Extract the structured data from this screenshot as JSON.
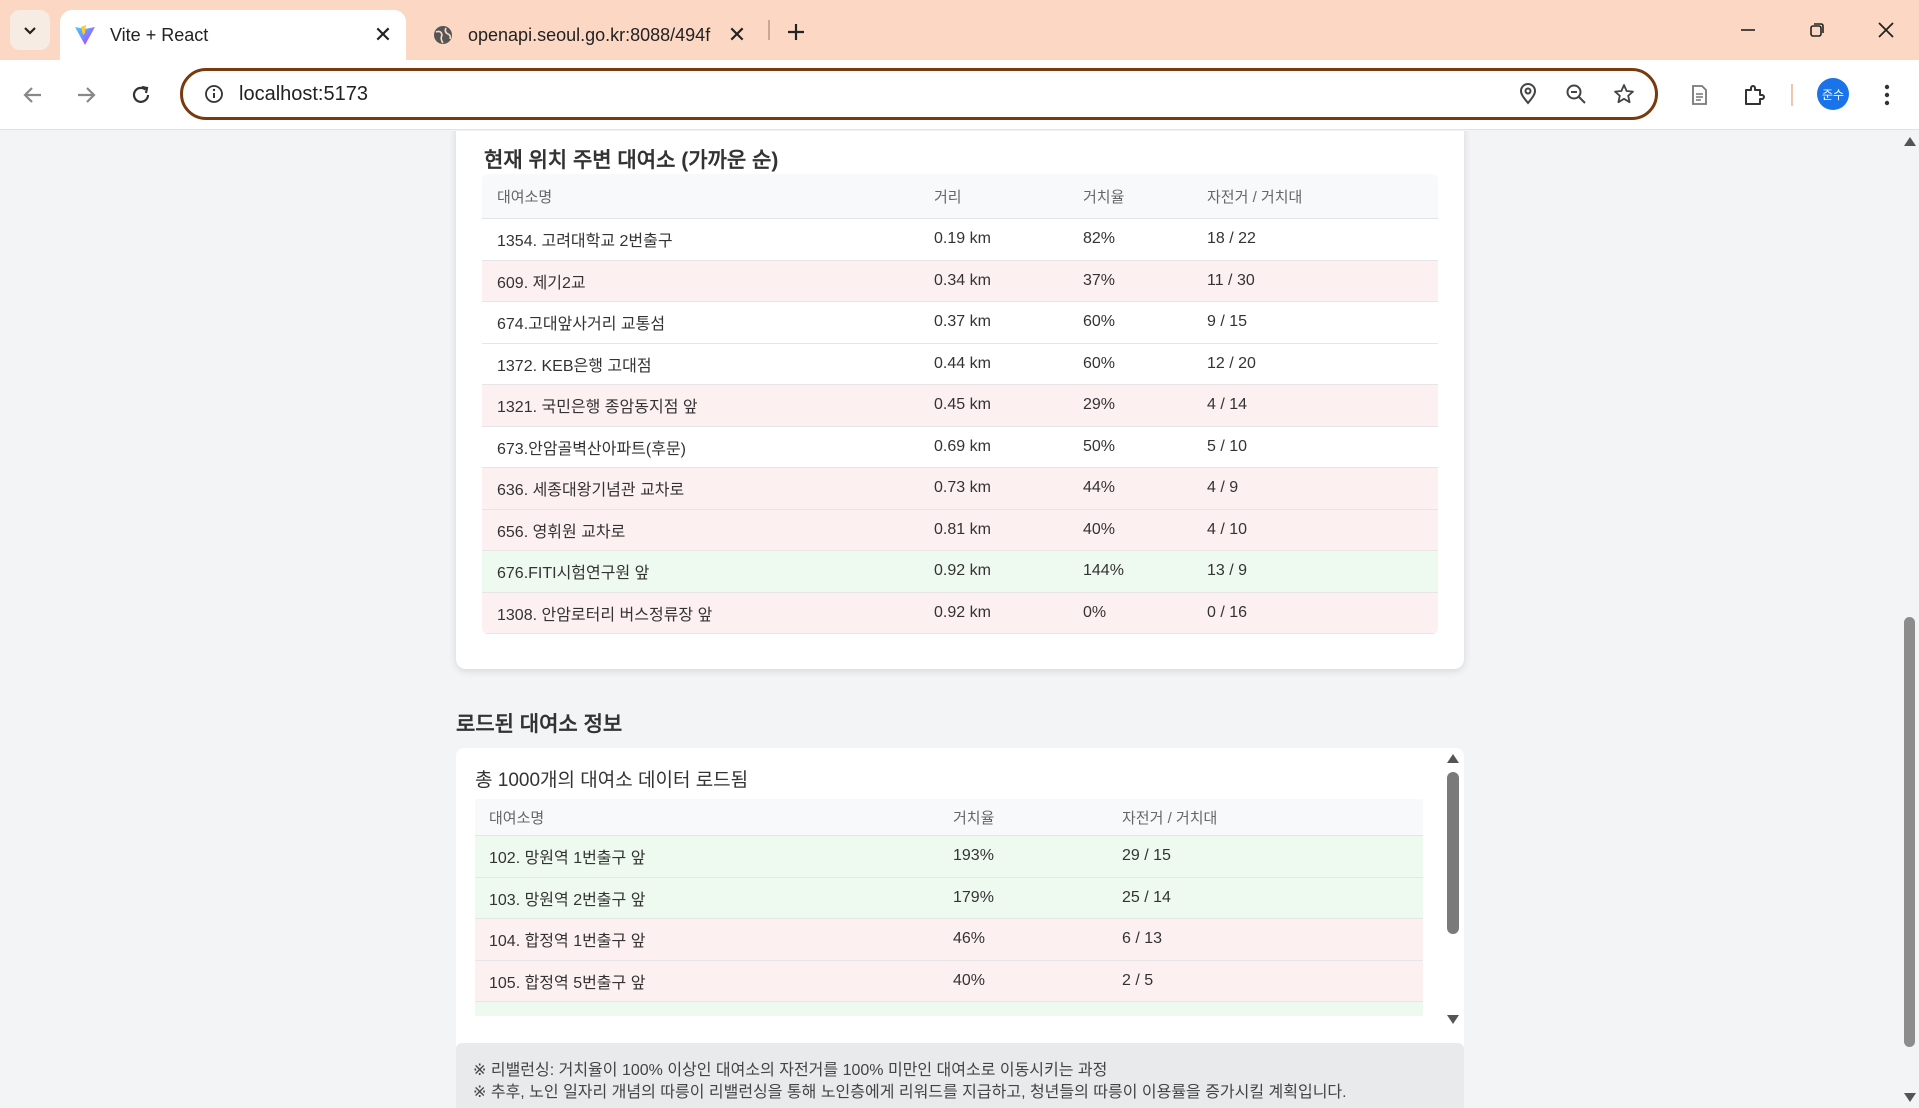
{
  "browser": {
    "tabs": [
      {
        "title": "Vite + React",
        "active": true,
        "icon": "vite-logo-icon"
      },
      {
        "title": "openapi.seoul.go.kr:8088/494f",
        "active": false,
        "icon": "globe-icon"
      }
    ],
    "url": "localhost:5173",
    "profile_initials": "준수"
  },
  "nearby": {
    "title": "현재 위치 주변 대여소 (가까운 순)",
    "columns": [
      "대여소명",
      "거리",
      "거치율",
      "자전거 / 거치대"
    ],
    "rows": [
      {
        "name": "1354. 고려대학교 2번출구",
        "distance": "0.19 km",
        "rate": "82%",
        "bikes": "18 / 22",
        "status": "normal"
      },
      {
        "name": "609. 제기2교",
        "distance": "0.34 km",
        "rate": "37%",
        "bikes": "11 / 30",
        "status": "low"
      },
      {
        "name": "674.고대앞사거리 교통섬",
        "distance": "0.37 km",
        "rate": "60%",
        "bikes": "9 / 15",
        "status": "normal"
      },
      {
        "name": "1372. KEB은행 고대점",
        "distance": "0.44 km",
        "rate": "60%",
        "bikes": "12 / 20",
        "status": "normal"
      },
      {
        "name": "1321. 국민은행 종암동지점 앞",
        "distance": "0.45 km",
        "rate": "29%",
        "bikes": "4 / 14",
        "status": "low"
      },
      {
        "name": "673.안암골벽산아파트(후문)",
        "distance": "0.69 km",
        "rate": "50%",
        "bikes": "5 / 10",
        "status": "normal"
      },
      {
        "name": "636. 세종대왕기념관 교차로",
        "distance": "0.73 km",
        "rate": "44%",
        "bikes": "4 / 9",
        "status": "low"
      },
      {
        "name": "656. 영휘원 교차로",
        "distance": "0.81 km",
        "rate": "40%",
        "bikes": "4 / 10",
        "status": "low"
      },
      {
        "name": "676.FITI시험연구원 앞",
        "distance": "0.92 km",
        "rate": "144%",
        "bikes": "13 / 9",
        "status": "high"
      },
      {
        "name": "1308. 안암로터리 버스정류장 앞",
        "distance": "0.92 km",
        "rate": "0%",
        "bikes": "0 / 16",
        "status": "low"
      }
    ]
  },
  "loaded": {
    "section_title": "로드된 대여소 정보",
    "summary": "총 1000개의 대여소 데이터 로드됨",
    "columns": [
      "대여소명",
      "거치율",
      "자전거 / 거치대"
    ],
    "rows": [
      {
        "name": "102. 망원역 1번출구 앞",
        "rate": "193%",
        "bikes": "29 / 15",
        "status": "high"
      },
      {
        "name": "103. 망원역 2번출구 앞",
        "rate": "179%",
        "bikes": "25 / 14",
        "status": "high"
      },
      {
        "name": "104. 합정역 1번출구 앞",
        "rate": "46%",
        "bikes": "6 / 13",
        "status": "low"
      },
      {
        "name": "105. 합정역 5번출구 앞",
        "rate": "40%",
        "bikes": "2 / 5",
        "status": "low"
      }
    ]
  },
  "notes": [
    "※ 리밸런싱: 거치율이 100% 이상인 대여소의 자전거를 100% 미만인 대여소로 이동시키는 과정",
    "※ 추후, 노인 일자리 개념의 따릉이 리밸런싱을 통해 노인층에게 리워드를 지급하고, 청년들의 따릉이 이용률을 증가시킬 계획입니다."
  ],
  "colors": {
    "row_normal": "#ffffff",
    "row_low": "#fdf0f0",
    "row_high": "#eefaf0",
    "omnibox_border": "#7a3a10",
    "tabbar_bg": "#fcd8c4"
  }
}
